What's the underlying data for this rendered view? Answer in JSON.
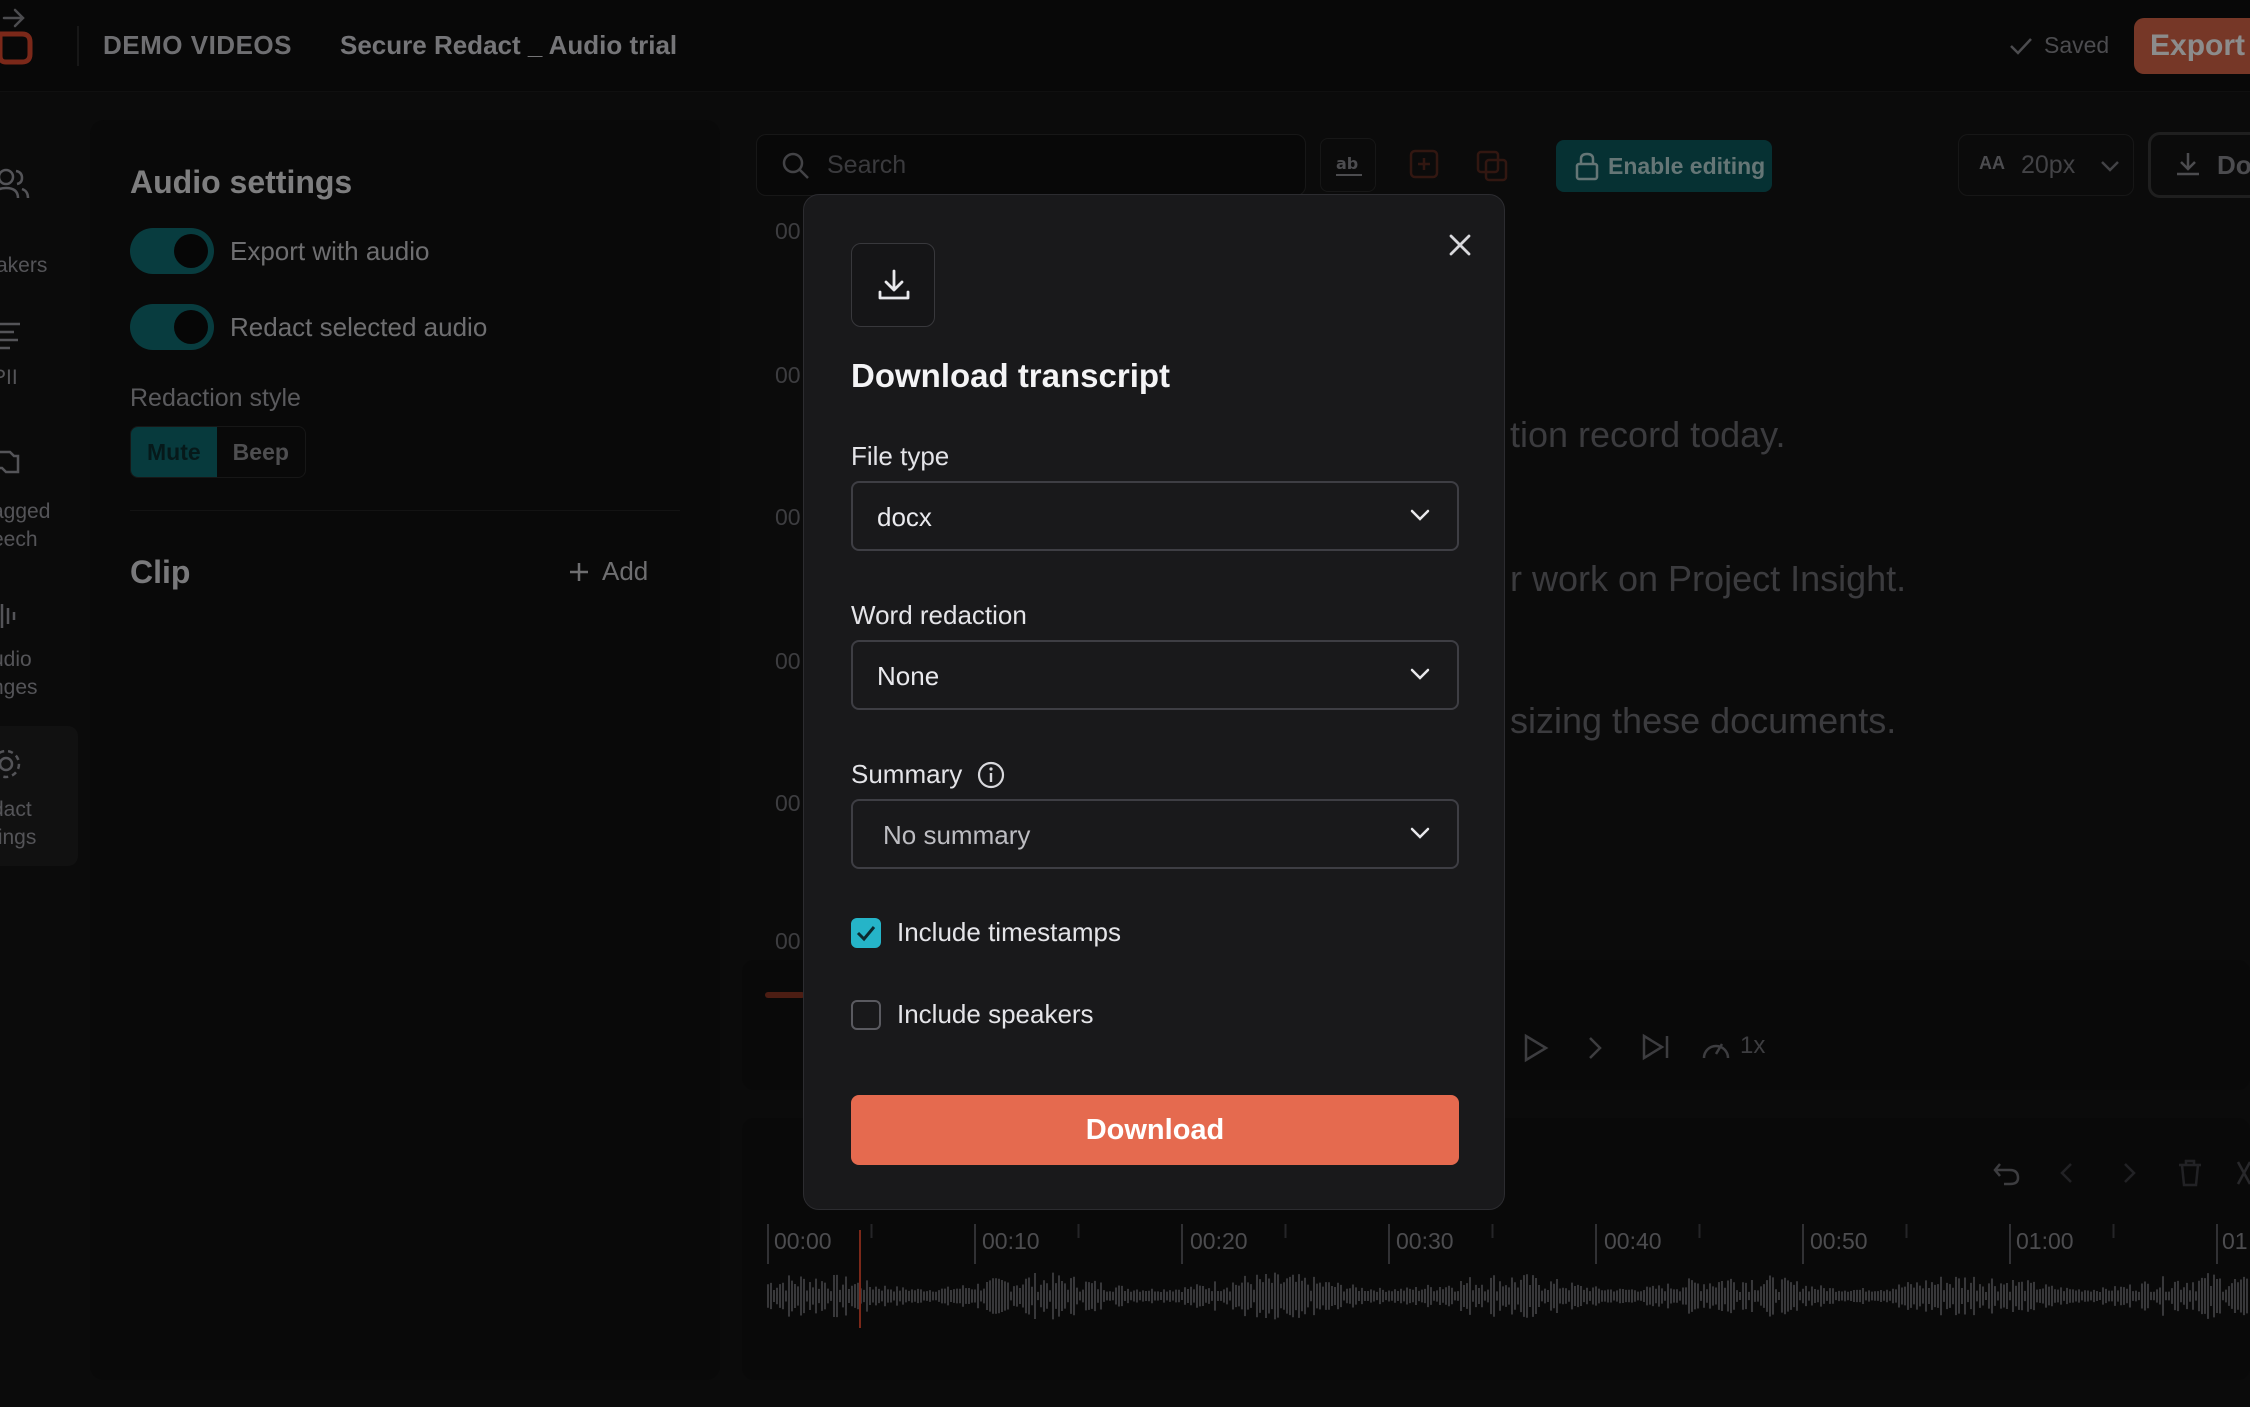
{
  "topbar": {
    "breadcrumb_root": "DEMO VIDEOS",
    "breadcrumb_page": "Secure Redact _ Audio trial",
    "saved_label": "Saved",
    "export_label": "Export"
  },
  "rail": {
    "items": [
      {
        "label": "akers",
        "icon": "users-icon"
      },
      {
        "label": "PII",
        "icon": "pii-icon"
      },
      {
        "label": "agged",
        "label2": "eech",
        "icon": "flag-icon"
      },
      {
        "label": "udio",
        "label2": "nges",
        "icon": "waveform-icon"
      },
      {
        "label": "dact",
        "label2": "tings",
        "icon": "gear-icon"
      }
    ]
  },
  "audio_settings": {
    "title": "Audio settings",
    "export_with_audio": "Export with audio",
    "redact_selected_audio": "Redact selected audio",
    "redaction_style_label": "Redaction style",
    "style_mute": "Mute",
    "style_beep": "Beep",
    "clip_title": "Clip",
    "add_label": "Add"
  },
  "editor": {
    "search_placeholder": "Search",
    "enable_editing": "Enable editing",
    "font_size_icon": "AA",
    "font_size": "20px",
    "download_label": "Dov",
    "timestamps": [
      "00",
      "00",
      "00",
      "00",
      "00",
      "00"
    ],
    "transcript_lines": [
      "tion record today.",
      "r work on Project Insight.",
      "sizing these documents."
    ],
    "speed": "1x",
    "timeline": [
      "00:00",
      "00:10",
      "00:20",
      "00:30",
      "00:40",
      "00:50",
      "01:00",
      "01"
    ]
  },
  "modal": {
    "title": "Download transcript",
    "file_type_label": "File type",
    "file_type_value": "docx",
    "word_redaction_label": "Word redaction",
    "word_redaction_value": "None",
    "summary_label": "Summary",
    "summary_value": "No summary",
    "include_timestamps": "Include timestamps",
    "include_timestamps_checked": true,
    "include_speakers": "Include speakers",
    "include_speakers_checked": false,
    "download_button": "Download"
  },
  "colors": {
    "accent": "#e56a4f",
    "teal": "#25b4c8",
    "toggle": "#0f6e73"
  }
}
